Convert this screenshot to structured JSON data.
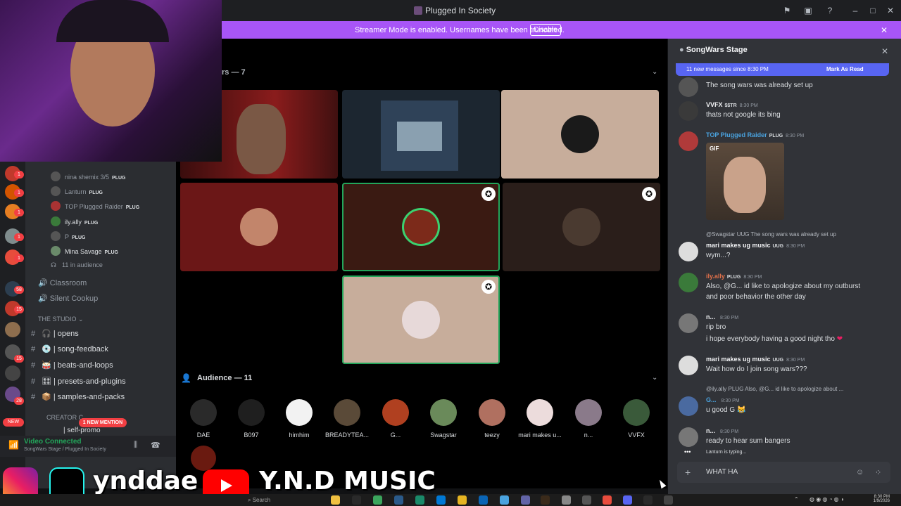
{
  "window": {
    "title": "Plugged In Society"
  },
  "banner": {
    "text": "Streamer Mode is enabled. Usernames have been truncated.",
    "button": "Disable"
  },
  "stage": {
    "speakers_header": "rs — 7",
    "audience_header": "Audience — 11",
    "audience": [
      "DAE",
      "B097",
      "himhim",
      "BREADYTEA...",
      "G...",
      "Swagstar",
      "teezy",
      "mari makes u...",
      "n...",
      "VVFX"
    ]
  },
  "sidebar": {
    "voice_users": [
      {
        "name": "nina shemix 3/5",
        "tag": "PLUG"
      },
      {
        "name": "Lanturn",
        "tag": "PLUG"
      },
      {
        "name": "TOP Plugged Raider",
        "tag": "PLUG"
      },
      {
        "name": "ily.ally",
        "tag": "PLUG"
      },
      {
        "name": "P",
        "tag": "PLUG"
      },
      {
        "name": "Mina Savage",
        "tag": "PLUG"
      }
    ],
    "in_audience": "11 in audience",
    "voice_channels": [
      "Classroom",
      "Silent Cookup"
    ],
    "category": "THE STUDIO",
    "text_channels": [
      "| opens",
      "| song-feedback",
      "| beats-and-loops",
      "| presets-and-plugins",
      "| samples-and-packs"
    ],
    "creator_cat": "CREATOR C",
    "self_promo": "| self-promo",
    "mention": "1 NEW MENTION",
    "new_label": "NEW",
    "badges": [
      "1",
      "1",
      "1",
      "1",
      "1",
      "58",
      "15",
      "15",
      "28"
    ],
    "vc_title": "Video Connected",
    "vc_sub": "SongWars Stage / Plugged In Society"
  },
  "overlay": {
    "tiktok": "ynddae",
    "youtube": "Y.N.D MUSIC"
  },
  "taskbar": {
    "search": "Search",
    "time": "8:30 PM",
    "date": "1/9/2026"
  },
  "chat": {
    "title": "SongWars Stage",
    "new_messages": "11 new messages since 8:30 PM",
    "mark_read": "Mark As Read",
    "messages": [
      {
        "name": "",
        "tag": "",
        "time": "",
        "lines": [
          "The song wars was already set up"
        ]
      },
      {
        "name": "VVFX",
        "tag": "$$TR",
        "time": "8:30 PM",
        "lines": [
          "thats not google its bing"
        ]
      },
      {
        "name": "TOP Plugged Raider",
        "tag": "PLUG",
        "time": "8:30 PM",
        "lines": []
      },
      {
        "name": "mari makes ug music",
        "tag": "UUG",
        "time": "8:30 PM",
        "lines": [
          "wym...?"
        ],
        "reply": "@Swagstar  UUG  The song wars was already set up"
      },
      {
        "name": "ily.ally",
        "tag": "PLUG",
        "time": "8:30 PM",
        "lines": [
          "Also, @G... id like to apologize about my outburst",
          "and poor behavior the other day"
        ]
      },
      {
        "name": "n...",
        "tag": "",
        "time": "8:30 PM",
        "lines": [
          "rip bro",
          "i hope everybody having a good night tho"
        ]
      },
      {
        "name": "mari makes ug music",
        "tag": "UUG",
        "time": "8:30 PM",
        "lines": [
          "Wait how do I join song wars???"
        ]
      },
      {
        "name": "G...",
        "tag": "",
        "time": "8:30 PM",
        "lines": [
          "u good G"
        ],
        "reply": "@ily.ally  PLUG  Also, @G... id like to apologize about ..."
      },
      {
        "name": "n...",
        "tag": "",
        "time": "8:30 PM",
        "lines": [
          "ready to hear sum bangers"
        ]
      }
    ],
    "gif_label": "GIF",
    "typing": "Lanturn is typing...",
    "composer_text": "WHAT HA"
  }
}
